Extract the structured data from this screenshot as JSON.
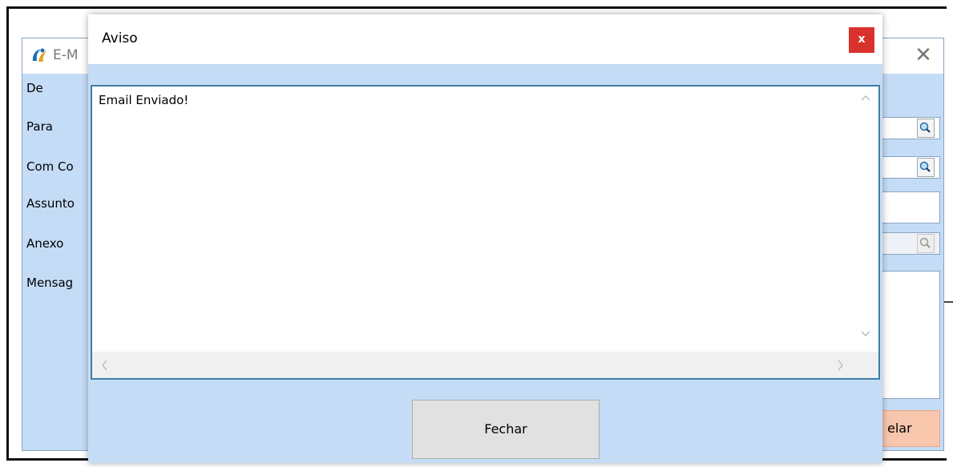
{
  "background_window": {
    "title": "E-M",
    "close_glyph": "✕",
    "labels": {
      "de": "De",
      "para": "Para",
      "com_copia": "Com Co",
      "assunto": "Assunto",
      "anexo": "Anexo",
      "mensagem": "Mensag"
    },
    "cancel_label": "elar",
    "logo_icon": "app-logo-icon",
    "search_icon": "magnifier-icon",
    "accent_color": "#c5dcf6",
    "cancel_color": "#f7c6ad"
  },
  "dialog": {
    "title": "Aviso",
    "close_glyph": "x",
    "close_color": "#d9322d",
    "message": "Email Enviado!",
    "button_label": "Fechar",
    "scroll_up": "^",
    "scroll_down": "v",
    "scroll_left": "<",
    "scroll_right": ">"
  }
}
